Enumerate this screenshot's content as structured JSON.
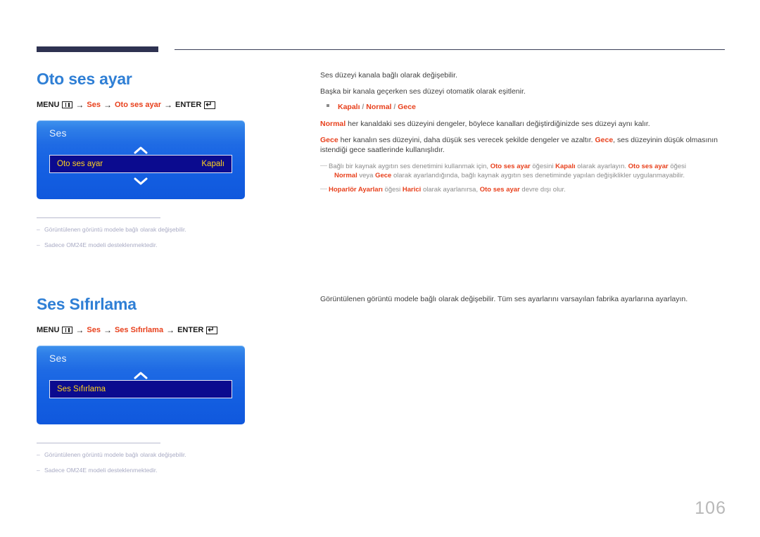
{
  "page": {
    "number": "106"
  },
  "sections": [
    {
      "title": "Oto ses ayar",
      "menu_path": {
        "menu_label": "MENU",
        "menu_icon": "menu-grid-icon",
        "arrow": "→",
        "crumb1": "Ses",
        "crumb2": "Oto ses ayar",
        "enter_label": "ENTER",
        "enter_icon": "enter-return-icon"
      },
      "osd": {
        "title": "Ses",
        "up_chevron": "chevron-up-icon",
        "down_chevron": "chevron-down-icon",
        "row_label": "Oto ses ayar",
        "row_value": "Kapalı"
      },
      "footnotes": [
        {
          "dash": "–",
          "text": "Görüntülenen görüntü modele bağlı olarak değişebilir."
        },
        {
          "dash": "–",
          "text": "Sadece OM24E modeli desteklenmektedir."
        }
      ]
    },
    {
      "title": "Ses Sıfırlama",
      "menu_path": {
        "menu_label": "MENU",
        "menu_icon": "menu-grid-icon",
        "arrow": "→",
        "crumb1": "Ses",
        "crumb2": "Ses Sıfırlama",
        "enter_label": "ENTER",
        "enter_icon": "enter-return-icon"
      },
      "osd": {
        "title": "Ses",
        "up_chevron": "chevron-up-icon",
        "row_label": "Ses Sıfırlama"
      },
      "footnotes": [
        {
          "dash": "–",
          "text": "Görüntülenen görüntü modele bağlı olarak değişebilir."
        },
        {
          "dash": "–",
          "text": "Sadece OM24E modeli desteklenmektedir."
        }
      ]
    }
  ],
  "content": {
    "s1": {
      "p1": "Ses düzeyi kanala bağlı olarak değişebilir.",
      "p2": "Başka bir kanala geçerken ses düzeyi otomatik olarak eşitlenir.",
      "bullet_opt1": "Kapalı",
      "bullet_sep1": " / ",
      "bullet_opt2": "Normal",
      "bullet_sep2": " / ",
      "bullet_opt3": "Gece",
      "p3_bold": "Normal",
      "p3_rest": " her kanaldaki ses düzeyini dengeler, böylece kanalları değiştirdiğinizde ses düzeyi aynı kalır.",
      "p4_bold1": "Gece",
      "p4_mid": " her kanalın ses düzeyini, daha düşük ses verecek şekilde dengeler ve azaltır. ",
      "p4_bold2": "Gece",
      "p4_rest": ", ses düzeyinin düşük olmasının istendiği gece saatlerinde kullanışlıdır.",
      "note1_a": "Bağlı bir kaynak aygıtın ses denetimini kullanmak için, ",
      "note1_b1": "Oto ses ayar",
      "note1_c": " öğesini ",
      "note1_b2": "Kapalı",
      "note1_d": " olarak ayarlayın. ",
      "note1_b3": "Oto ses ayar",
      "note1_e": " öğesi ",
      "note1_b4": "Normal",
      "note1_f": " veya ",
      "note1_b5": "Gece",
      "note1_g": " olarak ayarlandığında, bağlı kaynak aygıtın ses denetiminde yapılan değişiklikler uygulanmayabilir.",
      "note2_b1": "Hoparlör Ayarları",
      "note2_a": " öğesi ",
      "note2_b2": "Harici",
      "note2_b": " olarak ayarlanırsa, ",
      "note2_b3": "Oto ses ayar",
      "note2_c": " devre dışı olur."
    },
    "s2": {
      "p1": "Görüntülenen görüntü modele bağlı olarak değişebilir. Tüm ses ayarlarını varsayılan fabrika ayarlarına ayarlayın."
    }
  },
  "colors": {
    "heading": "#2f7fd5",
    "accent_red": "#e8401c",
    "osd_blue": "#1460e2",
    "osd_row_navy": "#0b0b8f",
    "osd_row_text": "#ffd21e",
    "rule_navy": "#2e3251"
  }
}
